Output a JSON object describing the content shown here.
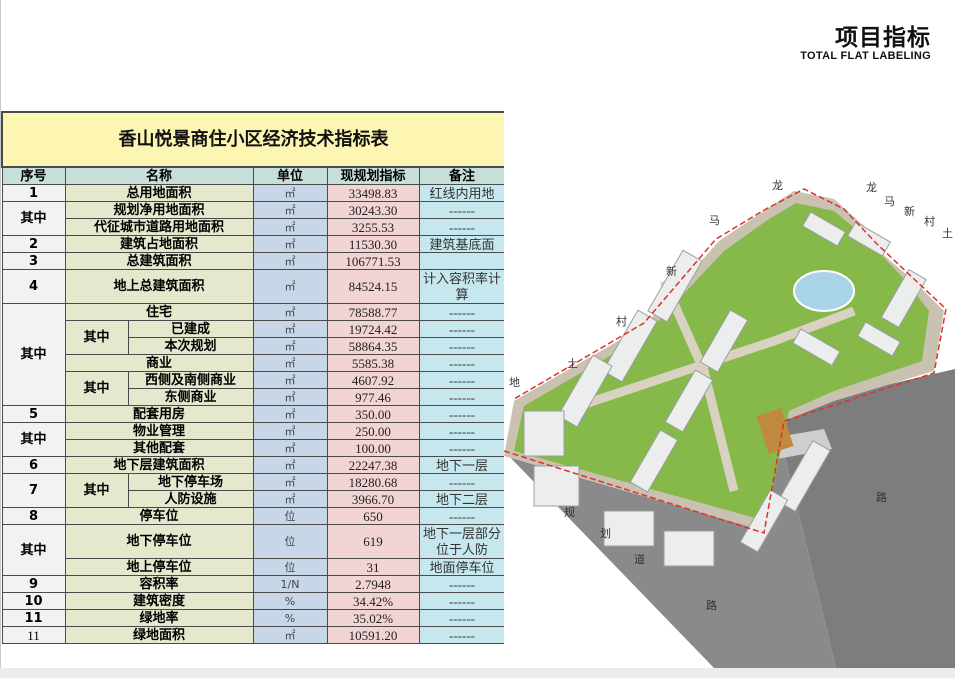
{
  "header": {
    "title": "项目指标",
    "subtitle": "TOTAL FLAT LABELING"
  },
  "table": {
    "title": "香山悦景商住小区经济技术指标表",
    "headers": {
      "seq": "序号",
      "name": "名称",
      "unit": "单位",
      "value": "现规划指标",
      "note": "备注"
    },
    "group_label": "其中",
    "rows": [
      {
        "seq": "1",
        "name": "总用地面积",
        "unit": "㎡",
        "value": "33498.83",
        "note": "红线内用地"
      },
      {
        "name": "规划净用地面积",
        "unit": "㎡",
        "value": "30243.30",
        "note": "------"
      },
      {
        "name": "代征城市道路用地面积",
        "unit": "㎡",
        "value": "3255.53",
        "note": "------"
      },
      {
        "seq": "2",
        "name": "建筑占地面积",
        "unit": "㎡",
        "value": "11530.30",
        "note": "建筑基底面"
      },
      {
        "seq": "3",
        "name": "总建筑面积",
        "unit": "㎡",
        "value": "106771.53",
        "note": ""
      },
      {
        "seq": "4",
        "name": "地上总建筑面积",
        "unit": "㎡",
        "value": "84524.15",
        "note": "计入容积率计算"
      },
      {
        "name": "住宅",
        "unit": "㎡",
        "value": "78588.77",
        "note": "------"
      },
      {
        "name": "已建成",
        "unit": "㎡",
        "value": "19724.42",
        "note": "------"
      },
      {
        "name": "本次规划",
        "unit": "㎡",
        "value": "58864.35",
        "note": "------"
      },
      {
        "name": "商业",
        "unit": "㎡",
        "value": "5585.38",
        "note": "------"
      },
      {
        "name": "西侧及南侧商业",
        "unit": "㎡",
        "value": "4607.92",
        "note": "------"
      },
      {
        "name": "东侧商业",
        "unit": "㎡",
        "value": "977.46",
        "note": "------"
      },
      {
        "seq": "5",
        "name": "配套用房",
        "unit": "㎡",
        "value": "350.00",
        "note": "------"
      },
      {
        "name": "物业管理",
        "unit": "㎡",
        "value": "250.00",
        "note": "------"
      },
      {
        "name": "其他配套",
        "unit": "㎡",
        "value": "100.00",
        "note": "------"
      },
      {
        "seq": "6",
        "name": "地下层建筑面积",
        "unit": "㎡",
        "value": "22247.38",
        "note": "地下一层"
      },
      {
        "name": "地下停车场",
        "unit": "㎡",
        "value": "18280.68",
        "note": "------"
      },
      {
        "name": "人防设施",
        "unit": "㎡",
        "value": "3966.70",
        "note": "地下二层"
      },
      {
        "seq": "8",
        "name": "停车位",
        "unit": "位",
        "value": "650",
        "note": "------"
      },
      {
        "name": "地下停车位",
        "unit": "位",
        "value": "619",
        "note": "地下一层部分位于人防"
      },
      {
        "name": "地上停车位",
        "unit": "位",
        "value": "31",
        "note": "地面停车位"
      },
      {
        "seq": "9",
        "name": "容积率",
        "unit": "1/N",
        "value": "2.7948",
        "note": "------"
      },
      {
        "seq": "10",
        "name": "建筑密度",
        "unit": "%",
        "value": "34.42%",
        "note": "------"
      },
      {
        "seq": "11",
        "name": "绿地率",
        "unit": "%",
        "value": "35.02%",
        "note": "------"
      },
      {
        "seq": "11",
        "name": "绿地面积",
        "unit": "㎡",
        "value": "10591.20",
        "note": "------"
      }
    ],
    "seq_7": "7"
  },
  "site_plan": {
    "road_labels": [
      "龙",
      "马",
      "新",
      "村",
      "土",
      "地",
      "龙",
      "马",
      "新",
      "村",
      "土",
      "规",
      "划",
      "道",
      "路",
      "路"
    ],
    "colors": {
      "red_line": "#e0312f",
      "grass": "#86b84a",
      "building": "#eceeee",
      "road": "#7d7d7d"
    }
  }
}
